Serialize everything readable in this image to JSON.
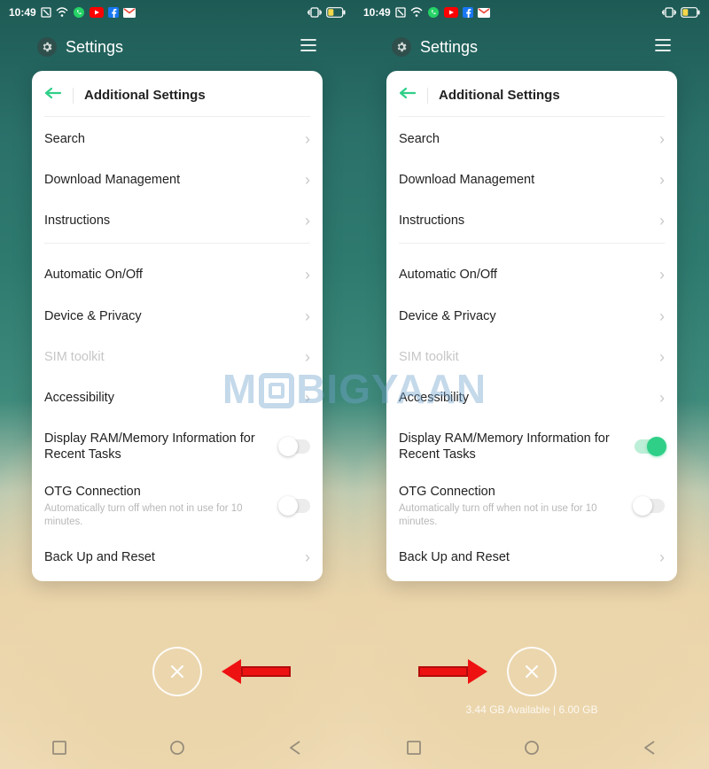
{
  "status": {
    "time": "10:49"
  },
  "recents": {
    "title": "Settings"
  },
  "colors": {
    "accent_green": "#2fcf88",
    "arrow_red": "#e11"
  },
  "card": {
    "title": "Additional Settings",
    "rows": {
      "search": "Search",
      "download": "Download Management",
      "instructions": "Instructions",
      "auto_onoff": "Automatic On/Off",
      "device_privacy": "Device & Privacy",
      "sim_toolkit": "SIM toolkit",
      "accessibility": "Accessibility",
      "display_ram": "Display RAM/Memory Information for Recent Tasks",
      "otg_title": "OTG Connection",
      "otg_sub": "Automatically turn off when not in use for 10 minutes.",
      "backup": "Back Up and Reset"
    }
  },
  "memory": {
    "text": "3.44 GB Available | 6.00 GB"
  },
  "watermark": {
    "pre": "M",
    "post": "BIGYAAN"
  }
}
